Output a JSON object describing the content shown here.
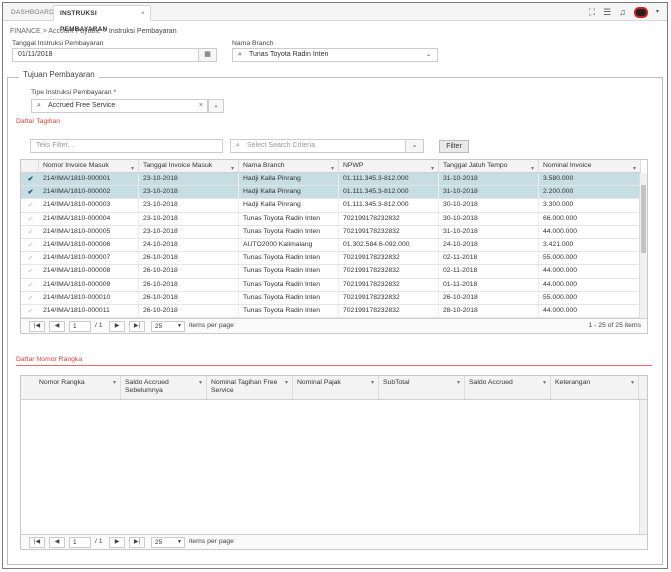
{
  "tabs": {
    "dashboard": "DASHBOARD",
    "active": "INSTRUKSI PEMBAYARAN",
    "close": "×"
  },
  "breadcrumb": {
    "a": "FINANCE",
    "sep1": ">",
    "b": "Account Payable",
    "sep2": ">",
    "c": "Instruksi Pembayaran"
  },
  "form": {
    "tanggal_label": "Tanggal Instruksi Pembayaran",
    "tanggal_value": "01/11/2018",
    "branch_label": "Nama Branch",
    "branch_value": "Tunas Toyota Radin Inten",
    "section_title": "Tujuan Pembayaran",
    "tipe_label": "Tipe Instruksi Pembayaran *",
    "tipe_value": "Accrued Free Service",
    "daftar_tagihan": "Daftar Tagihan",
    "teks_filter_placeholder": "Teks Filter...",
    "criteria_placeholder": "Select Search Criteria",
    "filter_btn": "Filter",
    "daftar_rangka": "Daftar Nomor Rangka"
  },
  "icons": {
    "expand": "expand-icon",
    "menu": "menu-icon",
    "bell": "bell-icon",
    "user": "user-badge-icon",
    "search": "search-icon",
    "calendar": "calendar-icon",
    "clear": "×",
    "chevron": "⌄",
    "check": "✔"
  },
  "invoice_table": {
    "columns": [
      "Nomor Invoice Masuk",
      "Tanggal Invoice Masuk",
      "Nama Branch",
      "NPWP",
      "Tanggal Jatuh Tempo",
      "Nominal Invoice"
    ],
    "rows": [
      {
        "sel": true,
        "no": "214/IMA/1810-000001",
        "tgl": "23-10-2018",
        "branch": "Hadji Kalla Pinrang",
        "npwp": "01.111.345.3-812.000",
        "jt": "31-10-2018",
        "nom": "3.580.000"
      },
      {
        "sel": true,
        "no": "214/IMA/1810-000002",
        "tgl": "23-10-2018",
        "branch": "Hadji Kalla Pinrang",
        "npwp": "01.111.345.3-812.000",
        "jt": "31-10-2018",
        "nom": "2.200.000"
      },
      {
        "sel": false,
        "no": "214/IMA/1810-000003",
        "tgl": "23-10-2018",
        "branch": "Hadji Kalla Pinrang",
        "npwp": "01.111.345.3-812.000",
        "jt": "30-10-2018",
        "nom": "3.300.000"
      },
      {
        "sel": false,
        "no": "214/IMA/1810-000004",
        "tgl": "23-10-2018",
        "branch": "Tunas Toyota Radin Inten",
        "npwp": "702199178232832",
        "jt": "30-10-2018",
        "nom": "66.000.000"
      },
      {
        "sel": false,
        "no": "214/IMA/1810-000005",
        "tgl": "23-10-2018",
        "branch": "Tunas Toyota Radin Inten",
        "npwp": "702199178232832",
        "jt": "31-10-2018",
        "nom": "44.000.000"
      },
      {
        "sel": false,
        "no": "214/IMA/1810-000006",
        "tgl": "24-10-2018",
        "branch": "AUTO2000 Kalimalang",
        "npwp": "01.302.584.6-092.000",
        "jt": "24-10-2018",
        "nom": "3.421.000"
      },
      {
        "sel": false,
        "no": "214/IMA/1810-000007",
        "tgl": "26-10-2018",
        "branch": "Tunas Toyota Radin Inten",
        "npwp": "702199178232832",
        "jt": "02-11-2018",
        "nom": "55.000.000"
      },
      {
        "sel": false,
        "no": "214/IMA/1810-000008",
        "tgl": "26-10-2018",
        "branch": "Tunas Toyota Radin Inten",
        "npwp": "702199178232832",
        "jt": "02-11-2018",
        "nom": "44.000.000"
      },
      {
        "sel": false,
        "no": "214/IMA/1810-000009",
        "tgl": "26-10-2018",
        "branch": "Tunas Toyota Radin Inten",
        "npwp": "702199178232832",
        "jt": "01-11-2018",
        "nom": "44.000.000"
      },
      {
        "sel": false,
        "no": "214/IMA/1810-000010",
        "tgl": "26-10-2018",
        "branch": "Tunas Toyota Radin Inten",
        "npwp": "702199178232832",
        "jt": "26-10-2018",
        "nom": "55.000.000"
      },
      {
        "sel": false,
        "no": "214/IMA/1810-000011",
        "tgl": "26-10-2018",
        "branch": "Tunas Toyota Radin Inten",
        "npwp": "702199178232832",
        "jt": "28-10-2018",
        "nom": "44.000.000"
      }
    ],
    "pager": {
      "page": "1",
      "of": "/ 1",
      "size": "25",
      "per_page": "items per page",
      "summary": "1 - 25 of 25 items"
    }
  },
  "rangka_table": {
    "columns": [
      "Nomor Rangka",
      "Saldo Accrued Sebelumnya",
      "Nominal Tagihan Free Service",
      "Nominal Pajak",
      "SubTotal",
      "Saldo Accrued",
      "Keterangan"
    ],
    "pager": {
      "page": "1",
      "of": "/ 1",
      "size": "25",
      "per_page": "items per page"
    }
  }
}
